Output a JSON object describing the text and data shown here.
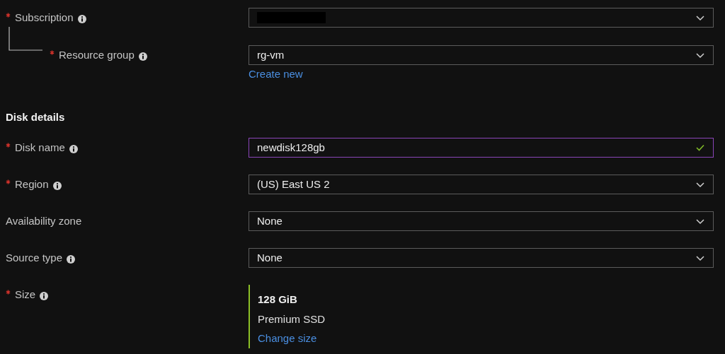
{
  "fields": [
    {
      "kind": "select",
      "label": "Subscription",
      "required": true,
      "info": true,
      "redacted": true,
      "children": [
        {
          "kind": "select",
          "label": "Resource group",
          "required": true,
          "info": true,
          "value": "rg-vm",
          "link": "Create new"
        }
      ]
    }
  ],
  "section": {
    "heading": "Disk details",
    "fields": [
      {
        "kind": "text",
        "label": "Disk name",
        "required": true,
        "info": true,
        "value": "newdisk128gb",
        "focused": true,
        "valid": true
      },
      {
        "kind": "select",
        "label": "Region",
        "required": true,
        "info": true,
        "value": "(US) East US 2"
      },
      {
        "kind": "select",
        "label": "Availability zone",
        "required": false,
        "info": false,
        "value": "None"
      },
      {
        "kind": "select",
        "label": "Source type",
        "required": false,
        "info": true,
        "value": "None"
      },
      {
        "kind": "size",
        "label": "Size",
        "required": true,
        "info": true,
        "size": "128 GiB",
        "tier": "Premium SSD",
        "link": "Change size"
      }
    ]
  }
}
